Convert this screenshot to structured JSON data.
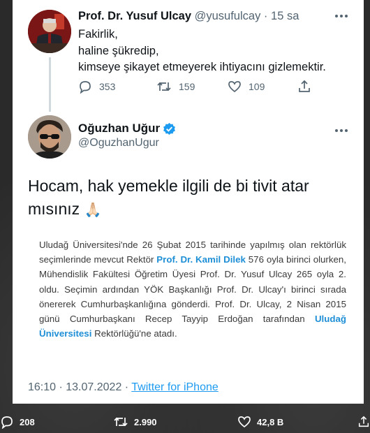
{
  "quoted_tweet": {
    "name": "Prof. Dr. Yusuf Ulcay",
    "handle": "@yusufulcay",
    "time": "15 sa",
    "lines": [
      "Fakirlik,",
      "haline şükredip,",
      "kimseye şikayet etmeyerek ihtiyacını gizlemektir."
    ],
    "replies": "353",
    "retweets": "159",
    "likes": "109"
  },
  "main_tweet": {
    "name": "Oğuzhan Uğur",
    "handle": "@OguzhanUgur",
    "text_line1": "Hocam, hak yemekle ilgili de bi tivit atar",
    "text_line2": "mısınız",
    "emoji": "🙏🏻",
    "clipping": {
      "part1": "Uludağ Üniversitesi'nde 26 Şubat 2015 tarihinde yapılmış olan rektörlük seçimlerinde mevcut Rektör ",
      "link1": "Prof. Dr. Kamil Dilek",
      "part2": " 576 oyla birinci olurken, Mühendislik Fakültesi Öğretim Üyesi Prof. Dr. Yusuf Ulcay 265 oyla 2. oldu. Seçimin ardından YÖK Başkanlığı Prof. Dr. Ulcay'ı birinci sırada önererek Cumhurbaşkanlığına gönderdi. Prof. Dr. Ulcay, 2 Nisan 2015 günü Cumhurbaşkanı Recep Tayyip Erdoğan tarafından ",
      "link2": "Uludağ Üniversitesi",
      "part3": " Rektörlüğü'ne atadı."
    },
    "timestamp": "16:10 · 13.07.2022 · ",
    "source": "Twitter for iPhone"
  },
  "bottom_bar": {
    "replies": "208",
    "retweets": "2.990",
    "likes": "42,8 B"
  },
  "colors": {
    "verified": "#1d9bf0",
    "link": "#1d9bf0",
    "secondary_text": "#536471"
  }
}
